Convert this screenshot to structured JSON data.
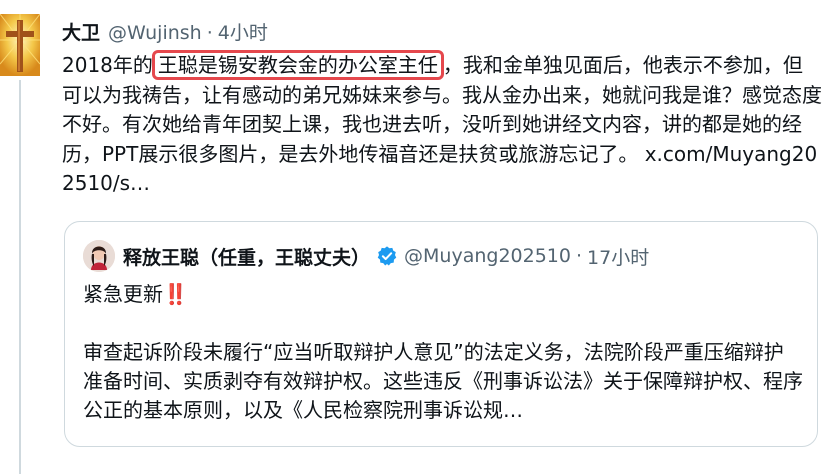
{
  "tweet": {
    "display_name": "大卫",
    "handle": "@Wujinsh",
    "separator": "·",
    "time": "4小时",
    "text_year": "2018年的",
    "text_highlight": "王聪是锡安教会金的办公室主任",
    "text_rest": "，我和金单独见面后，他表示不参加，但可以为我祷告，让有感动的弟兄姊妹来参与。我从金办出来，她就问我是谁？感觉态度不好。有次她给青年团契上课，我也进去听，没听到她讲经文内容，讲的都是她的经历，PPT展示很多图片，是去外地传福音还是扶贫或旅游忘记了。",
    "link": "x.com/Muyang202510/s…",
    "highlight_color": "#e5484d"
  },
  "quote": {
    "display_name": "释放王聪（任重，王聪丈夫）",
    "handle": "@Muyang202510",
    "separator": "·",
    "time": "17小时",
    "verified_icon": "verified-badge-icon",
    "verified_color": "#1d9bf0",
    "line1": "紧急更新",
    "line1_emoji": "‼️",
    "body": "审查起诉阶段未履行“应当听取辩护人意见”的法定义务，法院阶段严重压缩辩护准备时间、实质剥夺有效辩护权。这些违反《刑事诉讼法》关于保障辩护权、程序公正的基本原则，以及《人民检察院刑事诉讼规…"
  },
  "colors": {
    "text": "#0f1419",
    "secondary": "#536471",
    "border": "#cfd9de"
  }
}
